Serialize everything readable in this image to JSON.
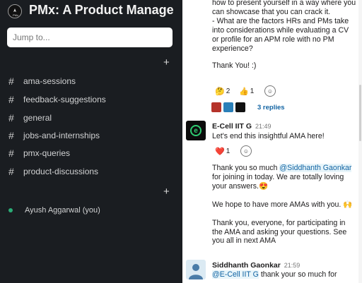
{
  "workspace": {
    "name": "PMx: A Product Managem...",
    "logo_text": "PMx"
  },
  "search": {
    "placeholder": "Jump to..."
  },
  "channels": [
    {
      "name": "ama-sessions"
    },
    {
      "name": "feedback-suggestions"
    },
    {
      "name": "general"
    },
    {
      "name": "jobs-and-internships"
    },
    {
      "name": "pmx-queries"
    },
    {
      "name": "product-discussions"
    }
  ],
  "dms": [
    {
      "name": "Ayush Aggarwal (you)",
      "status": "online"
    }
  ],
  "messages": {
    "first": {
      "lines": [
        "how to present yourself in a way where you can showcase that you can crack it.",
        "- What are the factors HRs and PMs take into considerations while evaluating a CV or profile for an APM role with no PM experience?",
        "Thank You! :)"
      ],
      "reactions": [
        {
          "emoji": "🤔",
          "count": "2"
        },
        {
          "emoji": "👍",
          "count": "1"
        }
      ],
      "thread": {
        "replies": "3 replies"
      }
    },
    "ecell": {
      "author": "E-Cell IIT G",
      "time": "21:49",
      "text1": "Let's end this insightful AMA here!",
      "reactions": [
        {
          "emoji": "❤️",
          "count": "1"
        }
      ],
      "text2_pre": "Thank you so much ",
      "text2_mention": "@Siddhanth Gaonkar",
      "text2_post": " for joining in today. We are totally loving your answers.😍",
      "text3": "We hope to have more AMAs with you. 🙌",
      "text4": "Thank you, everyone, for participating in the AMA and asking your questions. See you all in next AMA"
    },
    "siddhanth": {
      "author": "Siddhanth Gaonkar",
      "time": "21:59",
      "mention": "@E-Cell IIT G",
      "text": " thank your so much for"
    }
  },
  "colors": {
    "sidebar_bg": "#1a1d21",
    "link": "#1264a3",
    "online": "#2bac76"
  }
}
